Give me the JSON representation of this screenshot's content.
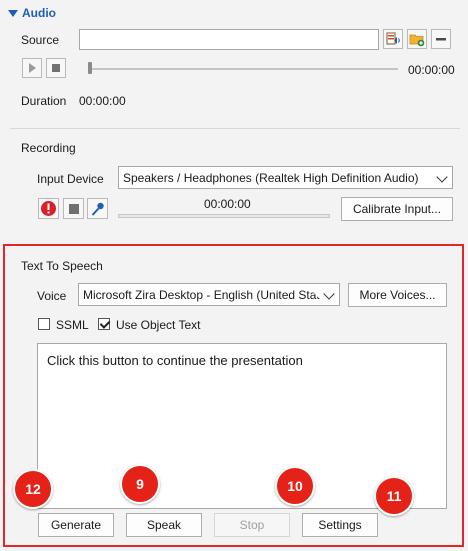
{
  "audio": {
    "header": "Audio",
    "source_label": "Source",
    "source_value": "",
    "time": "00:00:00",
    "duration_label": "Duration",
    "duration_value": "00:00:00"
  },
  "recording": {
    "title": "Recording",
    "input_device_label": "Input Device",
    "input_device_value": "Speakers / Headphones (Realtek High Definition Audio)",
    "time": "00:00:00",
    "calibrate_label": "Calibrate Input..."
  },
  "tts": {
    "title": "Text To Speech",
    "voice_label": "Voice",
    "voice_value": "Microsoft Zira Desktop - English (United State",
    "more_voices_label": "More Voices...",
    "ssml_label": "SSML",
    "ssml_checked": false,
    "use_object_text_label": "Use Object Text",
    "use_object_text_checked": true,
    "text": "Click this button to continue the presentation",
    "generate_label": "Generate",
    "speak_label": "Speak",
    "stop_label": "Stop",
    "settings_label": "Settings"
  },
  "callouts": {
    "generate": "12",
    "speak": "9",
    "stop": "10",
    "settings": "11"
  },
  "colors": {
    "accent": "#1f5fb3",
    "highlight_frame": "#e0282a",
    "callout": "#e42217"
  }
}
